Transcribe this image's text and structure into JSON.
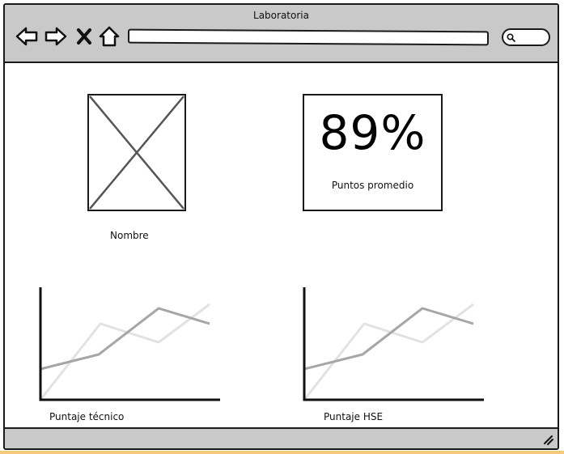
{
  "window": {
    "title": "Laboratoria"
  },
  "toolbar": {
    "back_icon": "arrow-left-icon",
    "forward_icon": "arrow-right-icon",
    "stop_icon": "close-icon",
    "home_icon": "home-icon",
    "search_icon": "search-icon"
  },
  "profile": {
    "name_label": "Nombre",
    "photo_icon": "image-placeholder-icon"
  },
  "score": {
    "value": "89%",
    "label": "Puntos promedio"
  },
  "charts": {
    "tecnico": {
      "label": "Puntaje técnico"
    },
    "hse": {
      "label": "Puntaje HSE"
    }
  },
  "colors": {
    "chrome": "#c9c9c9",
    "dark_series": "#a6a6a6",
    "light_series": "#e2e2e2",
    "stroke": "#1a1a1a"
  }
}
